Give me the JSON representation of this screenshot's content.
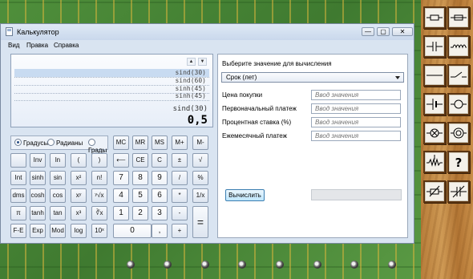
{
  "window": {
    "title": "Калькулятор",
    "btn_min": "—",
    "btn_max": "▢",
    "btn_close": "✕"
  },
  "menu": [
    "Вид",
    "Правка",
    "Справка"
  ],
  "display": {
    "history": [
      "sind(30)",
      "sind(60)",
      "sinh(45)",
      "sinh(45)"
    ],
    "expression": "sind(30)",
    "result": "0,5",
    "scroll_up": "▲",
    "scroll_down": "▼"
  },
  "angle_modes": [
    {
      "label": "Градусы",
      "selected": true
    },
    {
      "label": "Радианы",
      "selected": false
    },
    {
      "label": "Грады",
      "selected": false
    }
  ],
  "keys": {
    "mc": "MC",
    "mr": "MR",
    "ms": "MS",
    "mplus": "M+",
    "mminus": "M-",
    "inv": "Inv",
    "ln": "ln",
    "lparen": "(",
    "rparen": ")",
    "backspace": "⟵",
    "ce": "CE",
    "c": "C",
    "pm": "±",
    "sqrt": "√",
    "int": "Int",
    "sinh": "sinh",
    "sin": "sin",
    "x2": "x²",
    "fact": "n!",
    "seven": "7",
    "eight": "8",
    "nine": "9",
    "div": "/",
    "pct": "%",
    "dms": "dms",
    "cosh": "cosh",
    "cos": "cos",
    "xy": "xʸ",
    "yroot": "ʸ√x",
    "four": "4",
    "five": "5",
    "six": "6",
    "mul": "*",
    "recip": "1/x",
    "pi": "π",
    "tanh": "tanh",
    "tan": "tan",
    "x3": "x³",
    "cuberoot": "∛x",
    "one": "1",
    "two": "2",
    "three": "3",
    "sub": "-",
    "eq": "=",
    "fe": "F-E",
    "exp": "Exp",
    "mod": "Mod",
    "log": "log",
    "tenx": "10ˣ",
    "zero": "0",
    "dot": ",",
    "add": "+"
  },
  "right_panel": {
    "title": "Выберите значение для вычисления",
    "selected_mode": "Срок (лет)",
    "fields": [
      {
        "label": "Цена покупки",
        "placeholder": "Ввод значения"
      },
      {
        "label": "Первоначальный платеж",
        "placeholder": "Ввод значения"
      },
      {
        "label": "Процентная ставка (%)",
        "placeholder": "Ввод значения"
      },
      {
        "label": "Ежемесячный платеж",
        "placeholder": "Ввод значения"
      }
    ],
    "calculate_label": "Вычислить",
    "result_value": ""
  },
  "side_panel_icons": [
    "resistor-icon",
    "fuse-icon",
    "capacitor-icon",
    "inductor-icon",
    "wire-icon",
    "switch-icon",
    "capacitor-icon",
    "lamp-icon",
    "lamp-cross-icon",
    "meter-icon",
    "potentiometer-icon",
    "help-icon",
    "variable-resistor-icon",
    "variable-capacitor-icon"
  ],
  "side_panel_help": "?"
}
